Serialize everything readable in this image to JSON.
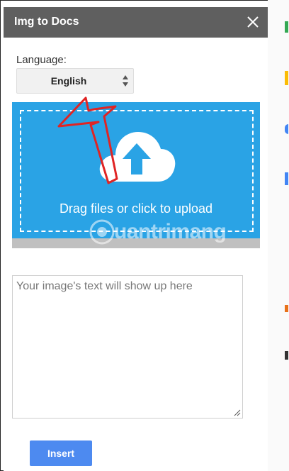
{
  "panel": {
    "title": "Img to Docs",
    "close_icon": "close-icon"
  },
  "language": {
    "label": "Language:",
    "selected": "English"
  },
  "upload": {
    "text": "Drag files or click to upload",
    "icon": "cloud-upload-icon",
    "bg_color": "#2aa3e5"
  },
  "watermark": {
    "text": "uantrimang"
  },
  "output": {
    "placeholder": "Your image's text will show up here"
  },
  "actions": {
    "insert_label": "Insert",
    "accent": "#4d8af0"
  }
}
